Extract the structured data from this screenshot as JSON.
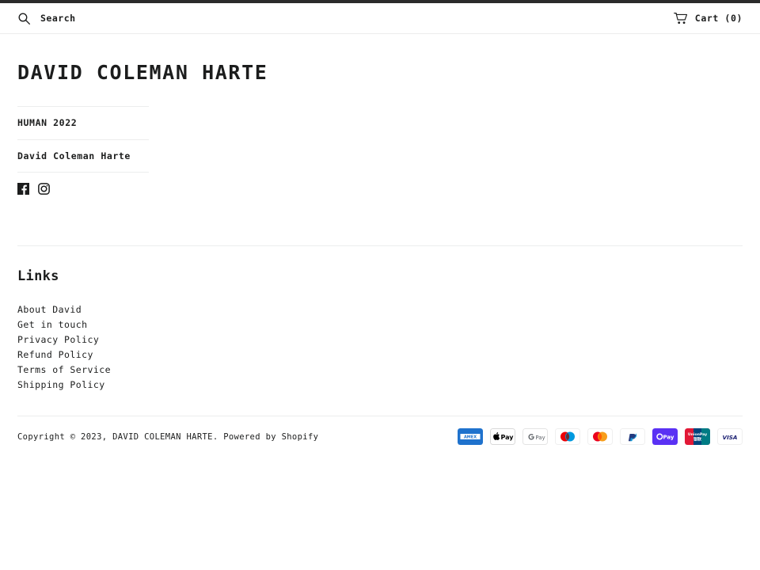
{
  "header": {
    "search": {
      "icon": "search-icon",
      "placeholder": "Search",
      "value": ""
    },
    "cart": {
      "icon": "cart-icon",
      "label": "Cart (0)",
      "count": 0
    }
  },
  "site": {
    "title": "DAVID COLEMAN HARTE"
  },
  "nav": {
    "items": [
      {
        "label": "HUMAN 2022"
      },
      {
        "label": "David Coleman Harte"
      }
    ],
    "social": [
      {
        "name": "facebook-icon",
        "label": "Facebook"
      },
      {
        "name": "instagram-icon",
        "label": "Instagram"
      }
    ]
  },
  "content": {
    "broken_image_glyph": " "
  },
  "footer": {
    "links_heading": "Links",
    "links": [
      {
        "label": "About David"
      },
      {
        "label": "Get in touch"
      },
      {
        "label": "Privacy Policy"
      },
      {
        "label": "Refund Policy"
      },
      {
        "label": "Terms of Service"
      },
      {
        "label": "Shipping Policy"
      }
    ],
    "copyright": {
      "prefix": "Copyright © 2023, ",
      "shop": "DAVID COLEMAN HARTE",
      "middle": ". Powered by ",
      "platform": "Shopify"
    },
    "payment_methods": [
      {
        "name": "american-express",
        "label": "AMEX"
      },
      {
        "name": "apple-pay",
        "label": "Pay"
      },
      {
        "name": "google-pay",
        "label": "Pay"
      },
      {
        "name": "maestro",
        "label": "Maestro"
      },
      {
        "name": "mastercard",
        "label": "Mastercard"
      },
      {
        "name": "paypal",
        "label": "PayPal"
      },
      {
        "name": "shop-pay",
        "label": "Pay"
      },
      {
        "name": "union-pay",
        "label": "UnionPay"
      },
      {
        "name": "visa",
        "label": "VISA"
      }
    ]
  },
  "colors": {
    "text": "#1c1d1d",
    "rule": "#eceded",
    "topbar": "#2b2b2b",
    "amex_blue": "#1F72CD",
    "gpay_blue": "#4285F4",
    "maestro_blue": "#0099DF",
    "maestro_red": "#ED0006",
    "mastercard_red": "#EB001B",
    "mastercard_orange": "#F79E1B",
    "paypal_blue": "#253B80",
    "shoppay_purple": "#5A31F4",
    "unionpay_red": "#E21836",
    "unionpay_teal": "#00A2B4",
    "visa_blue": "#1A1F71"
  }
}
